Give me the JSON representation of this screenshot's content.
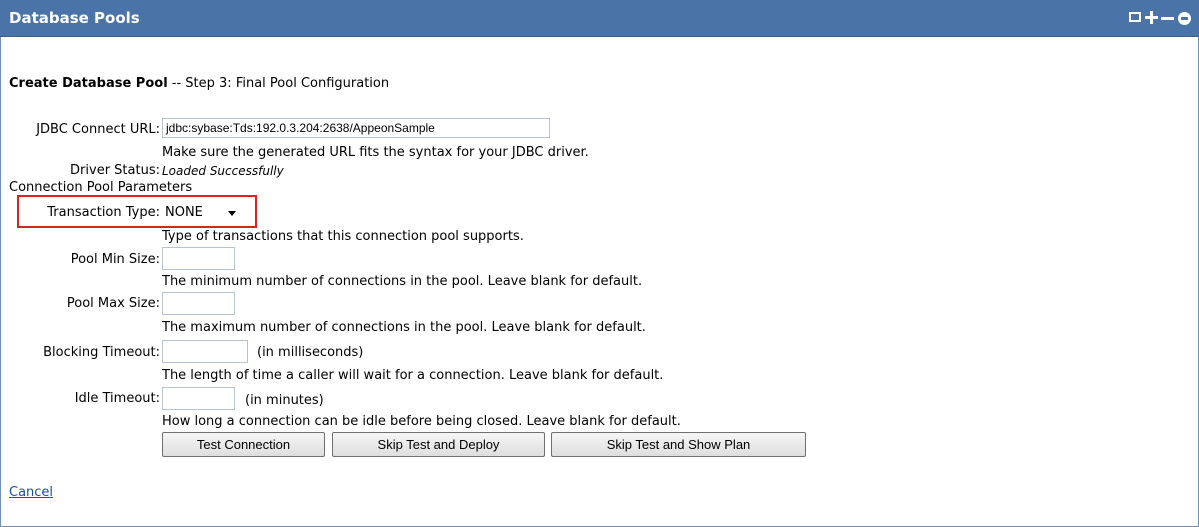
{
  "window": {
    "title": "Database Pools",
    "controls": [
      "restore-icon",
      "add-icon",
      "minimize-icon",
      "close-icon"
    ]
  },
  "heading": {
    "bold": "Create Database Pool",
    "rest": " -- Step 3: Final Pool Configuration"
  },
  "jdbc": {
    "label": "JDBC Connect URL:",
    "value": "jdbc:sybase:Tds:192.0.3.204:2638/AppeonSample",
    "hint": "Make sure the generated URL fits the syntax for your JDBC driver."
  },
  "driver": {
    "label": "Driver Status:",
    "value": "Loaded Successfully"
  },
  "section": "Connection Pool Parameters",
  "transaction": {
    "label": "Transaction Type:",
    "value": "NONE",
    "hint": "Type of transactions that this connection pool supports."
  },
  "pool_min": {
    "label": "Pool Min Size:",
    "value": "",
    "hint": "The minimum number of connections in the pool. Leave blank for default."
  },
  "pool_max": {
    "label": "Pool Max Size:",
    "value": "",
    "hint": "The maximum number of connections in the pool. Leave blank for default."
  },
  "blocking": {
    "label": "Blocking Timeout:",
    "value": "",
    "unit": "(in milliseconds)",
    "hint": "The length of time a caller will wait for a connection. Leave blank for default."
  },
  "idle": {
    "label": "Idle Timeout:",
    "value": "",
    "unit": "(in minutes)",
    "hint": "How long a connection can be idle before being closed. Leave blank for default."
  },
  "buttons": {
    "test": "Test Connection",
    "deploy": "Skip Test and Deploy",
    "plan": "Skip Test and Show Plan"
  },
  "cancel": "Cancel"
}
